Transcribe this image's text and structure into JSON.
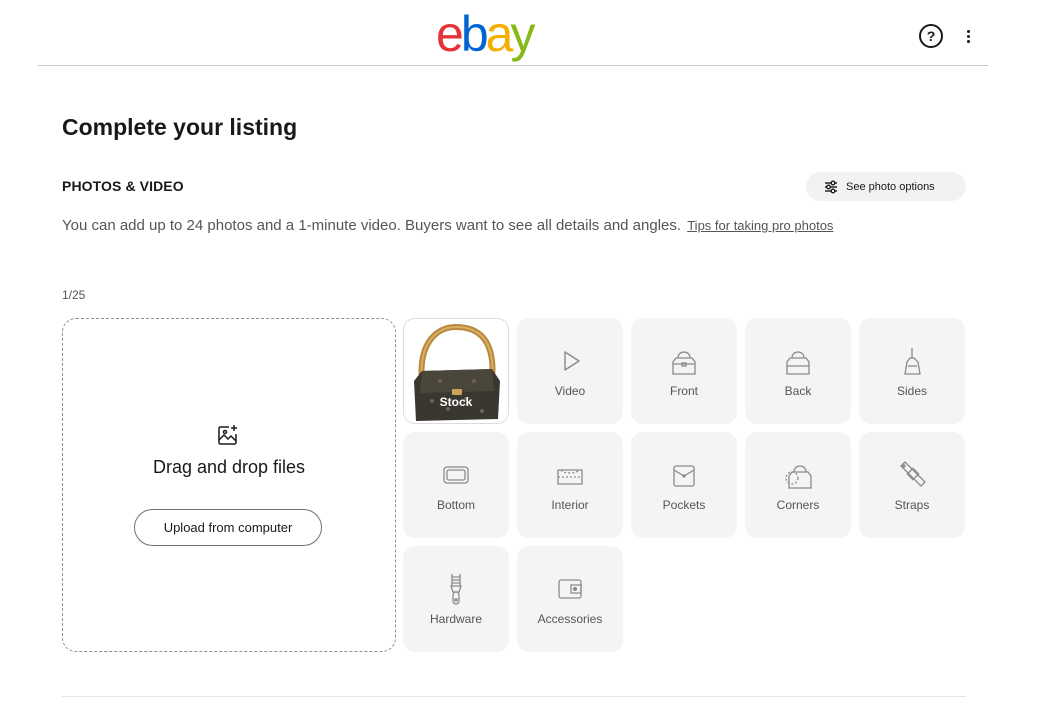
{
  "header": {
    "logo": {
      "e": "e",
      "b": "b",
      "a": "a",
      "y": "y"
    },
    "help_label": "?"
  },
  "page_title": "Complete your listing",
  "photos": {
    "section_title": "PHOTOS & VIDEO",
    "options_button": "See photo options",
    "description": "You can add up to 24 photos and a 1-minute video. Buyers want to see all details and angles.",
    "tips_link": "Tips for taking pro photos",
    "count": "1/25",
    "dropzone": {
      "text": "Drag and drop files",
      "upload_button": "Upload from computer"
    },
    "stock_label": "Stock",
    "tiles": [
      {
        "label": "Video",
        "icon": "play-icon"
      },
      {
        "label": "Front",
        "icon": "bag-front-icon"
      },
      {
        "label": "Back",
        "icon": "bag-back-icon"
      },
      {
        "label": "Sides",
        "icon": "bag-side-icon"
      },
      {
        "label": "Bottom",
        "icon": "bag-bottom-icon"
      },
      {
        "label": "Interior",
        "icon": "bag-interior-icon"
      },
      {
        "label": "Pockets",
        "icon": "pocket-icon"
      },
      {
        "label": "Corners",
        "icon": "bag-corner-icon"
      },
      {
        "label": "Straps",
        "icon": "strap-icon"
      },
      {
        "label": "Hardware",
        "icon": "zipper-icon"
      },
      {
        "label": "Accessories",
        "icon": "wallet-icon"
      }
    ]
  },
  "colors": {
    "ebay_red": "#e53238",
    "ebay_blue": "#0064d2",
    "ebay_yellow": "#f5af02",
    "ebay_green": "#86b817"
  }
}
